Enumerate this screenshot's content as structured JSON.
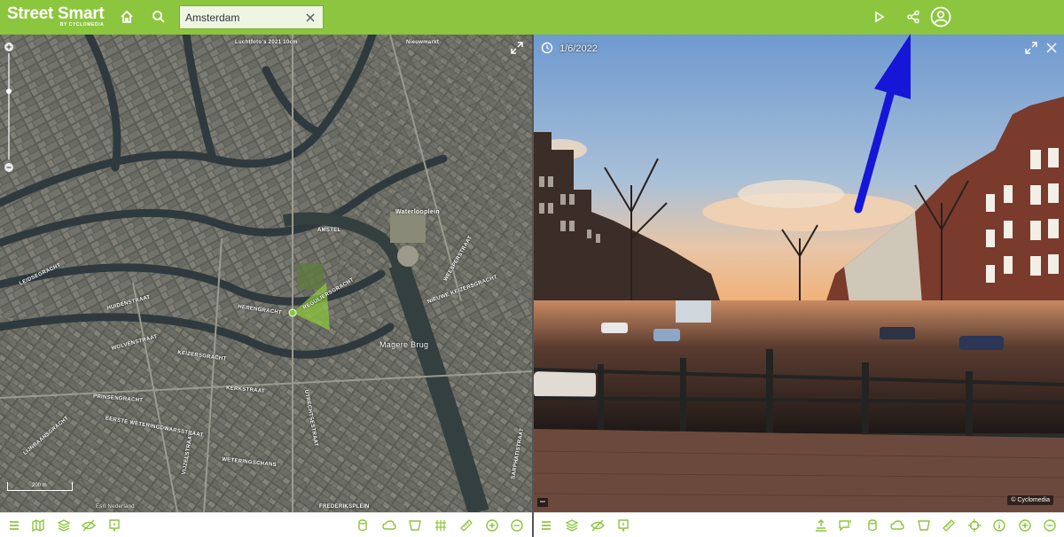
{
  "app": {
    "name": "Street Smart",
    "byline": "BY CYCLOMEDIA"
  },
  "search": {
    "value": "Amsterdam"
  },
  "map": {
    "top_label": "Luchtfoto's 2021 10cm",
    "top_label_right": "Nieuwmarkt",
    "labels": [
      "REGULIERSGRACHT",
      "HERENGRACHT",
      "KEIZERSGRACHT",
      "PRINSENGRACHT",
      "AMSTEL",
      "Magere Brug",
      "Waterlooplein",
      "WEESPERSTRAAT",
      "UTRECHTSESTRAAT",
      "VIJZELSTRAAT",
      "NIEUWE KEIZERSGRACHT",
      "LEIDSEGRACHT",
      "KERKSTRAAT",
      "HUIDENSTRAAT",
      "WOLVENSTRAAT",
      "EERSTE WETERINGDWARSSTRAAT",
      "LIJNBAANSGRACHT",
      "WETERINGSCHANS",
      "FREDERIKSPLEIN",
      "SARPHATISTRAAT"
    ],
    "scale_label": "200 m",
    "copyright": "Esri Nederland"
  },
  "pano": {
    "date": "1/6/2022",
    "copyright": "© Cyclomedia"
  },
  "colors": {
    "brand": "#8cc63e",
    "brand_dark": "#5e9a1e",
    "arrow": "#1616d8"
  },
  "icons": {
    "top": [
      "home-icon",
      "search-icon",
      "play-icon",
      "share-icon",
      "user-icon"
    ],
    "map_toolbar": [
      "menu-icon",
      "map-icon",
      "layers-icon",
      "visibility-off-icon",
      "info-icon",
      "cylinder-icon",
      "cloud-icon",
      "bucket-icon",
      "grid-icon",
      "ruler-icon",
      "zoom-in-icon",
      "zoom-out-icon"
    ],
    "pano_toolbar": [
      "menu-icon",
      "layers-icon",
      "visibility-off-icon",
      "info-icon",
      "elevation-icon",
      "comment-icon",
      "cylinder-icon",
      "cloud-icon",
      "bucket-icon",
      "ruler-icon",
      "crosshair-icon",
      "info-circle-icon",
      "zoom-in-icon",
      "zoom-out-icon"
    ]
  }
}
